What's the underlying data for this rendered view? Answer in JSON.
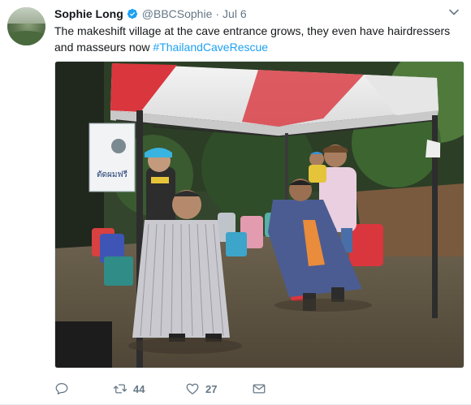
{
  "tweet": {
    "author": {
      "display_name": "Sophie Long",
      "handle": "@BBCSophie",
      "verified": true
    },
    "separator": "·",
    "time": "Jul 6",
    "text": "The makeshift village at the cave entrance grows, they even have hairdressers and masseurs now ",
    "hashtag": "#ThailandCaveRescue",
    "sign_text": "ตัดผมฟรี",
    "stats": {
      "retweets": "44",
      "likes": "27"
    },
    "icons": {
      "verified": "verified-badge-icon",
      "caret": "chevron-down-icon",
      "reply": "reply-icon",
      "retweet": "retweet-icon",
      "like": "heart-icon",
      "message": "envelope-icon"
    },
    "colors": {
      "text": "#14171a",
      "secondary": "#657786",
      "link": "#1da1f2",
      "verified": "#1da1f2"
    }
  }
}
